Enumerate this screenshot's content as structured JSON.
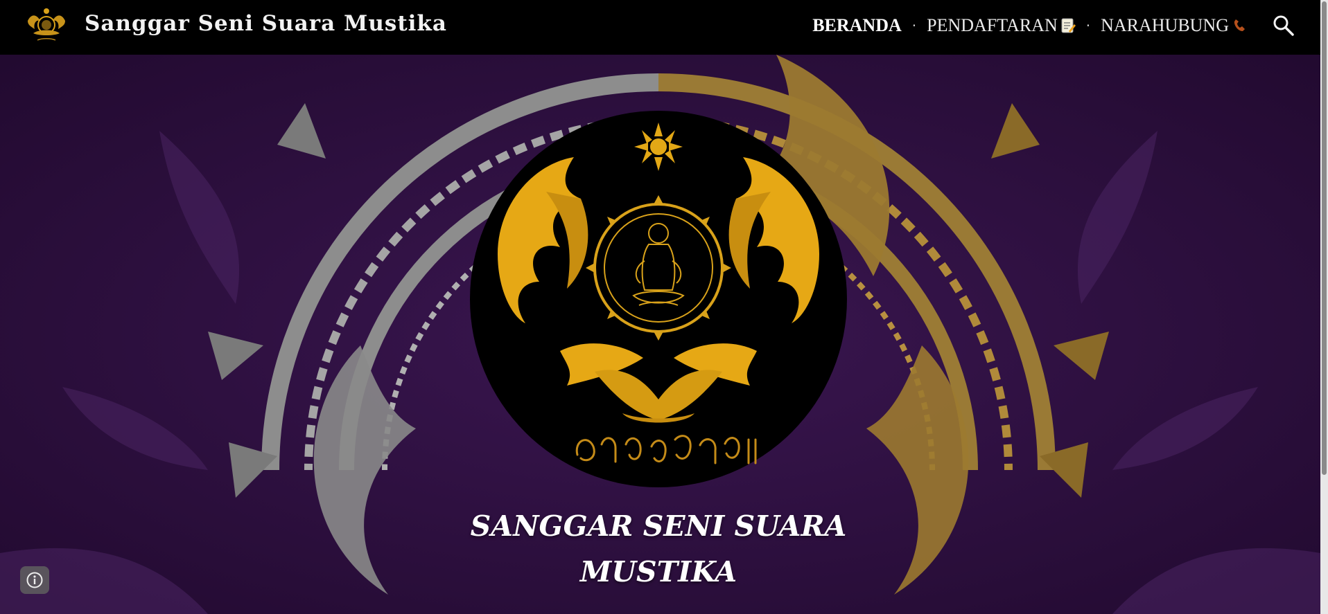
{
  "header": {
    "site_title": "Sanggar Seni Suara Mustika",
    "nav": [
      {
        "label": "BERANDA",
        "active": true
      },
      {
        "label": "PENDAFTARAN",
        "emoji": "memo-icon"
      },
      {
        "label": "NARAHUBUNG",
        "emoji": "telephone-receiver-icon"
      }
    ],
    "separator": "·",
    "search_icon": "search-icon"
  },
  "hero": {
    "title_line1": "SANGGAR SENI SUARA",
    "title_line2": "MUSTIKA",
    "background_color": "#2a0f3a",
    "accent_gold": "#e3a816"
  },
  "footer": {
    "info_icon": "info-icon"
  }
}
